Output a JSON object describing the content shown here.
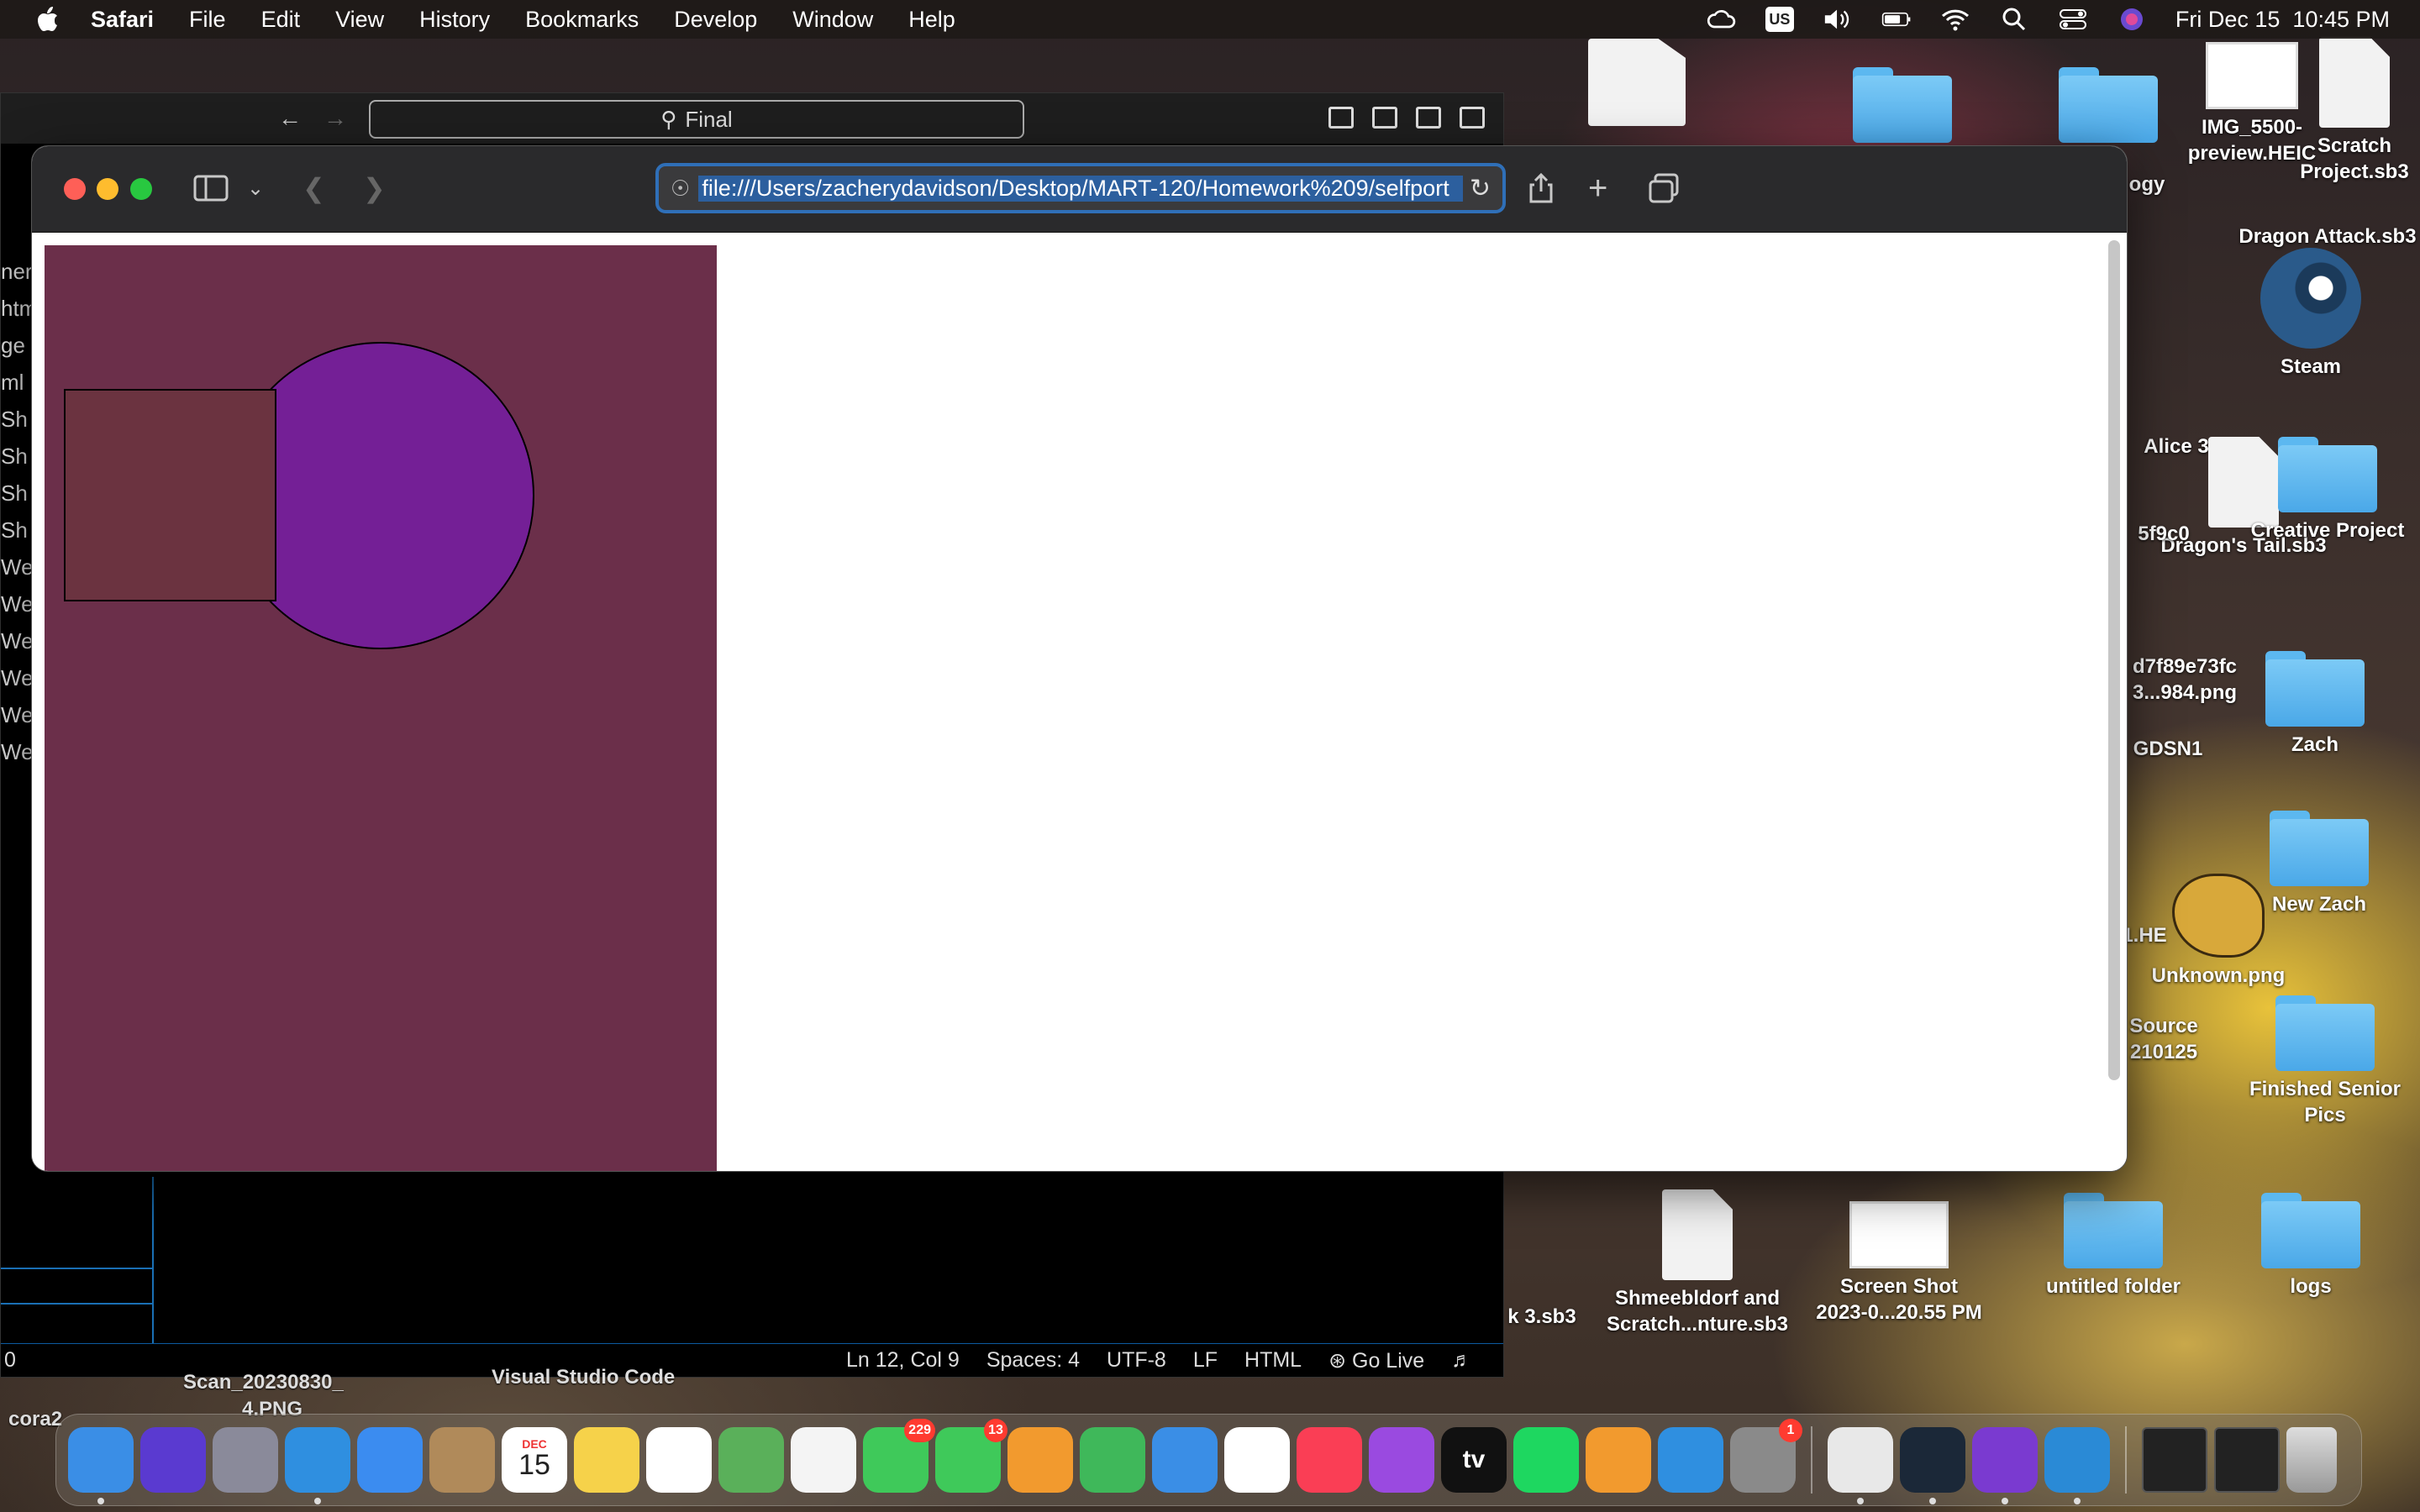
{
  "menubar": {
    "app": "Safari",
    "items": [
      "File",
      "Edit",
      "View",
      "History",
      "Bookmarks",
      "Develop",
      "Window",
      "Help"
    ],
    "input_source": "US",
    "datetime": "Fri Dec 15  10:45 PM"
  },
  "background_window": {
    "search_label": "Final",
    "sidebar_lines": [
      "ner",
      "htm",
      "ge",
      "ml",
      "Sh",
      "Sh",
      "Sh",
      "Sh",
      "We",
      "We",
      "We",
      "We",
      "We",
      "We"
    ],
    "status": {
      "left": "0",
      "cursor": "Ln 12, Col 9",
      "spaces": "Spaces: 4",
      "encoding": "UTF-8",
      "eol": "LF",
      "language": "HTML",
      "golive": "Go Live"
    },
    "under_labels": [
      "Scan_20230830_",
      "4.PNG",
      "Visual Studio Code",
      "cora2"
    ]
  },
  "safari": {
    "url": "file:///Users/zacherydavidson/Desktop/MART-120/Homework%209/selfport",
    "canvas": {
      "background": "#6b2f4a",
      "circle_fill": "#741f96",
      "rect_fill": "#6b3340"
    }
  },
  "desktop_icons": [
    {
      "label": "IMG_5500-\npreview.HEIC",
      "kind": "thumb"
    },
    {
      "label": "Scratch\nProject.sb3",
      "kind": "doc"
    },
    {
      "label": "Dragon Attack.sb3",
      "kind": "none"
    },
    {
      "label": "Steam",
      "kind": "steam"
    },
    {
      "label": "Alice 3",
      "kind": "none"
    },
    {
      "label": "Dragon's Tail.sb3",
      "kind": "doc"
    },
    {
      "label": "Creative Project",
      "kind": "folder"
    },
    {
      "label": "5f9c0",
      "kind": "none"
    },
    {
      "label": "d7f89e73fc\n3...984.png",
      "kind": "none"
    },
    {
      "label": "Zach",
      "kind": "folder"
    },
    {
      "label": "GDSN1",
      "kind": "none"
    },
    {
      "label": "New Zach",
      "kind": "folder"
    },
    {
      "label": "Unknown.png",
      "kind": "palette"
    },
    {
      "label": "Source\n210125",
      "kind": "none"
    },
    {
      "label": "Finished Senior\nPics",
      "kind": "folder"
    },
    {
      "label": "k 3.sb3",
      "kind": "none"
    },
    {
      "label": "Shmeebldorf and\nScratch...nture.sb3",
      "kind": "doc"
    },
    {
      "label": "Screen Shot\n2023-0...20.55 PM",
      "kind": "thumb"
    },
    {
      "label": "untitled folder",
      "kind": "folder"
    },
    {
      "label": "logs",
      "kind": "folder"
    },
    {
      "label": "ogy",
      "kind": "none"
    },
    {
      "label": "1.HE",
      "kind": "none"
    }
  ],
  "dock": {
    "apps": [
      {
        "name": "Finder",
        "color": "#3a8ee6"
      },
      {
        "name": "Siri",
        "color": "#5a3ad0"
      },
      {
        "name": "Launchpad",
        "color": "#8a8a9a"
      },
      {
        "name": "Safari",
        "color": "#2f8fe0"
      },
      {
        "name": "Mail",
        "color": "#3b8cf0"
      },
      {
        "name": "Contacts",
        "color": "#b08a5a"
      },
      {
        "name": "Calendar",
        "color": "#ffffff",
        "text": "15",
        "month": "DEC"
      },
      {
        "name": "Notes",
        "color": "#f6d24a"
      },
      {
        "name": "Reminders",
        "color": "#ffffff"
      },
      {
        "name": "Maps",
        "color": "#5ab05a"
      },
      {
        "name": "Photos",
        "color": "#f4f4f4"
      },
      {
        "name": "Messages",
        "color": "#3fc95a",
        "badge": "229"
      },
      {
        "name": "FaceTime",
        "color": "#3fc95a",
        "badge": "13"
      },
      {
        "name": "Pages",
        "color": "#f29a2e"
      },
      {
        "name": "Numbers",
        "color": "#3fb85a"
      },
      {
        "name": "Keynote",
        "color": "#3a8ee6"
      },
      {
        "name": "News",
        "color": "#ffffff"
      },
      {
        "name": "Music",
        "color": "#fa3e55"
      },
      {
        "name": "Podcasts",
        "color": "#9a4ae0"
      },
      {
        "name": "TV",
        "color": "#111111",
        "text": "tv"
      },
      {
        "name": "Spotify",
        "color": "#1ed760"
      },
      {
        "name": "Books",
        "color": "#f29a2e"
      },
      {
        "name": "App Store",
        "color": "#2f8fe0"
      },
      {
        "name": "System Settings",
        "color": "#8a8a8a",
        "badge": "1"
      },
      {
        "name": "Chrome",
        "color": "#e8e8e8"
      },
      {
        "name": "Steam",
        "color": "#1b2838"
      },
      {
        "name": "GitHub Desktop",
        "color": "#7a3ad0"
      },
      {
        "name": "VS Code",
        "color": "#2a8ad6"
      }
    ]
  }
}
